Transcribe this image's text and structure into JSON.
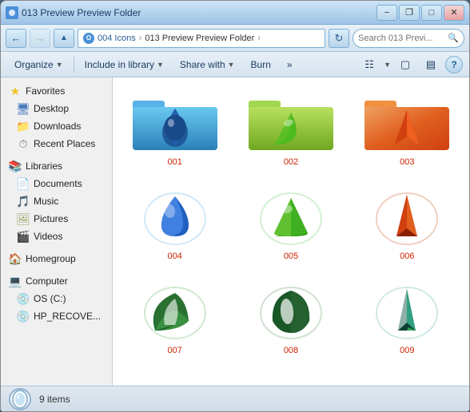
{
  "window": {
    "title": "013 Preview Preview Folder",
    "titlebar_buttons": {
      "minimize": "−",
      "maximize": "□",
      "close": "✕",
      "restore": "❐"
    }
  },
  "address": {
    "breadcrumb": "004 Icons › 013 Preview Preview Folder",
    "parts": [
      "004 Icons",
      "013 Preview Preview Folder"
    ],
    "search_placeholder": "Search 013 Previ..."
  },
  "toolbar": {
    "organize": "Organize",
    "include_library": "Include in library",
    "share_with": "Share with",
    "burn": "Burn",
    "more": "»"
  },
  "sidebar": {
    "favorites_label": "Favorites",
    "favorites": [
      {
        "label": "Desktop",
        "icon": "desktop"
      },
      {
        "label": "Downloads",
        "icon": "folder"
      },
      {
        "label": "Recent Places",
        "icon": "recent"
      }
    ],
    "libraries_label": "Libraries",
    "libraries": [
      {
        "label": "Documents",
        "icon": "document"
      },
      {
        "label": "Music",
        "icon": "music"
      },
      {
        "label": "Pictures",
        "icon": "pictures"
      },
      {
        "label": "Videos",
        "icon": "videos"
      }
    ],
    "homegroup_label": "Homegroup",
    "computer_label": "Computer",
    "computer_items": [
      {
        "label": "OS (C:)",
        "icon": "drive"
      },
      {
        "label": "HP_RECOVE...",
        "icon": "drive"
      }
    ]
  },
  "files": [
    {
      "id": "001",
      "label": "001",
      "type": "folder_blue"
    },
    {
      "id": "002",
      "label": "002",
      "type": "folder_green"
    },
    {
      "id": "003",
      "label": "003",
      "type": "folder_orange"
    },
    {
      "id": "004",
      "label": "004",
      "type": "drop_blue"
    },
    {
      "id": "005",
      "label": "005",
      "type": "gem_green"
    },
    {
      "id": "006",
      "label": "006",
      "type": "arrow_red"
    },
    {
      "id": "007",
      "label": "007",
      "type": "leaf_green"
    },
    {
      "id": "008",
      "label": "008",
      "type": "leaf_dark"
    },
    {
      "id": "009",
      "label": "009",
      "type": "arrow_teal"
    }
  ],
  "status": {
    "count": "9 items",
    "preview_icon": "oval_teal"
  }
}
